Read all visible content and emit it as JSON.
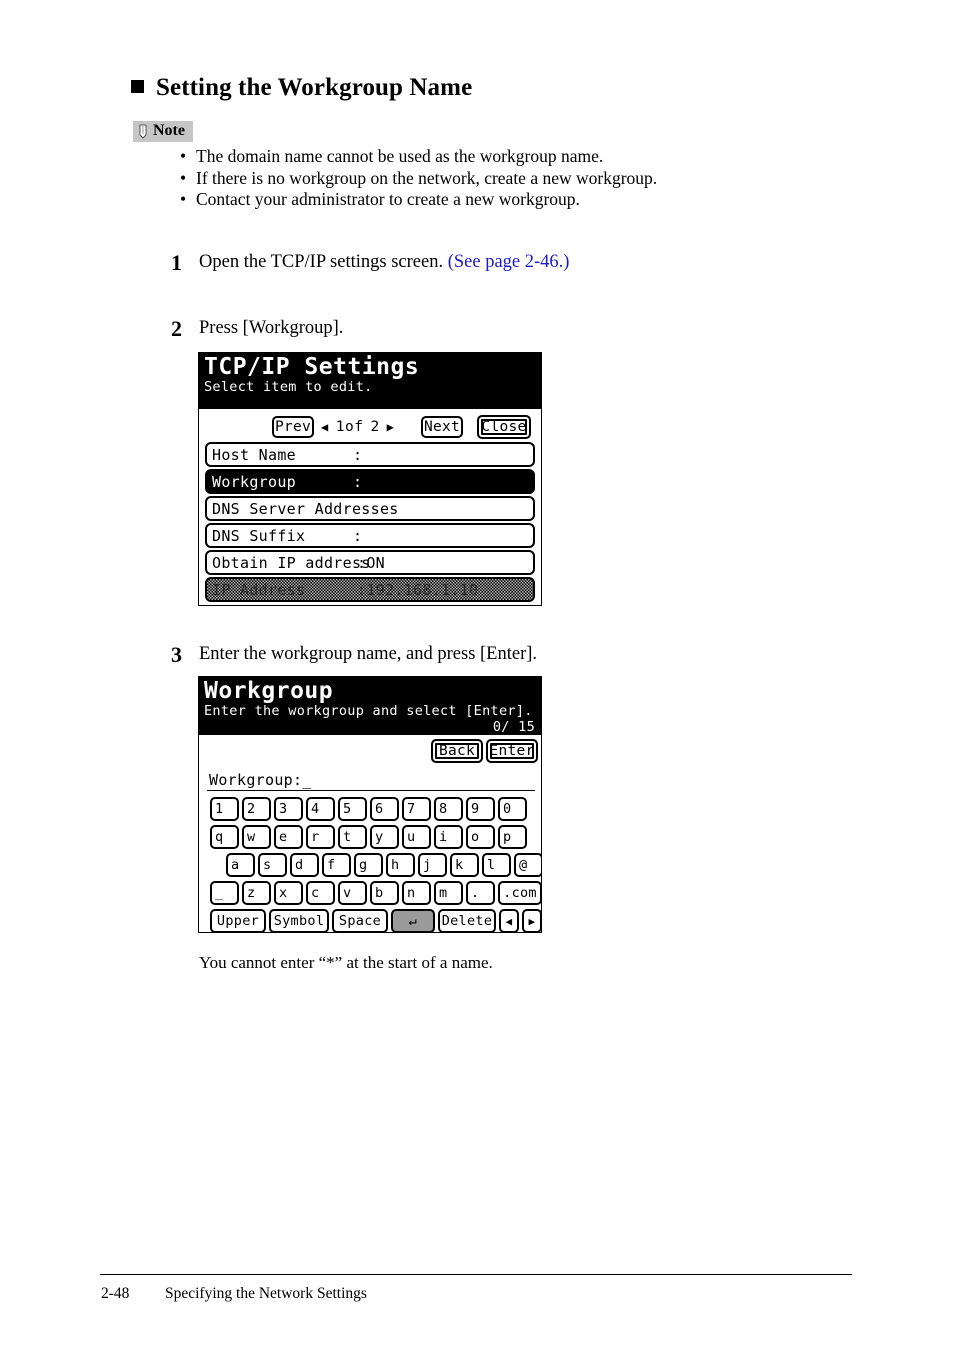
{
  "heading": {
    "text": "Setting the Workgroup Name"
  },
  "note": {
    "label": "Note",
    "icon": "pencil-icon",
    "items": [
      "The domain name cannot be used as the workgroup name.",
      "If there is no workgroup on the network, create a new workgroup.",
      "Contact your administrator to create a new workgroup."
    ]
  },
  "steps": [
    {
      "number": "1",
      "text": "Open the TCP/IP settings screen. ",
      "link": "(See page 2-46.)"
    },
    {
      "number": "2",
      "text": "Press [Workgroup].",
      "link": ""
    },
    {
      "number": "3",
      "text": "Enter the workgroup name, and press [Enter].",
      "link": ""
    }
  ],
  "caption": "You cannot enter “*” at the start of a name.",
  "screen_tcpip": {
    "title": "TCP/IP Settings",
    "subtitle": "Select item to edit.",
    "nav": {
      "prev_label": "Prev",
      "left_arrow": "◀",
      "page_text": "1of",
      "page_total": "2",
      "right_arrow": "▶",
      "next_label": "Next",
      "close_label": "Close"
    },
    "rows": [
      {
        "label": "Host Name",
        "colon": ":",
        "value": "",
        "state": "normal"
      },
      {
        "label": "Workgroup",
        "colon": ":",
        "value": "",
        "state": "selected"
      },
      {
        "label": "DNS Server Addresses",
        "colon": "",
        "value": "",
        "state": "normal"
      },
      {
        "label": "DNS Suffix",
        "colon": ":",
        "value": "",
        "state": "normal"
      },
      {
        "label": "Obtain IP address",
        "colon": "",
        "value": ":ON",
        "state": "normal"
      },
      {
        "label": "IP Address",
        "colon": "",
        "value": ":192.168.1.10",
        "state": "dimmed"
      }
    ]
  },
  "screen_workgroup": {
    "title": "Workgroup",
    "subtitle": "Enter the workgroup and select [Enter].",
    "counter": "0/ 15",
    "back_label": "Back",
    "enter_label": "Enter",
    "field_label": "Workgroup:_",
    "keyboard": {
      "row1": [
        "1",
        "2",
        "3",
        "4",
        "5",
        "6",
        "7",
        "8",
        "9",
        "0"
      ],
      "row2": [
        "q",
        "w",
        "e",
        "r",
        "t",
        "y",
        "u",
        "i",
        "o",
        "p"
      ],
      "row3": [
        "a",
        "s",
        "d",
        "f",
        "g",
        "h",
        "j",
        "k",
        "l",
        "@"
      ],
      "row4": [
        "_",
        "z",
        "x",
        "c",
        "v",
        "b",
        "n",
        "m",
        ".",
        ".com"
      ],
      "function_row": [
        "Upper",
        "Symbol",
        "Space",
        "↵",
        "Delete",
        "◀",
        "▶"
      ]
    }
  },
  "footer": {
    "page_number": "2-48",
    "section": "Specifying the Network Settings"
  }
}
